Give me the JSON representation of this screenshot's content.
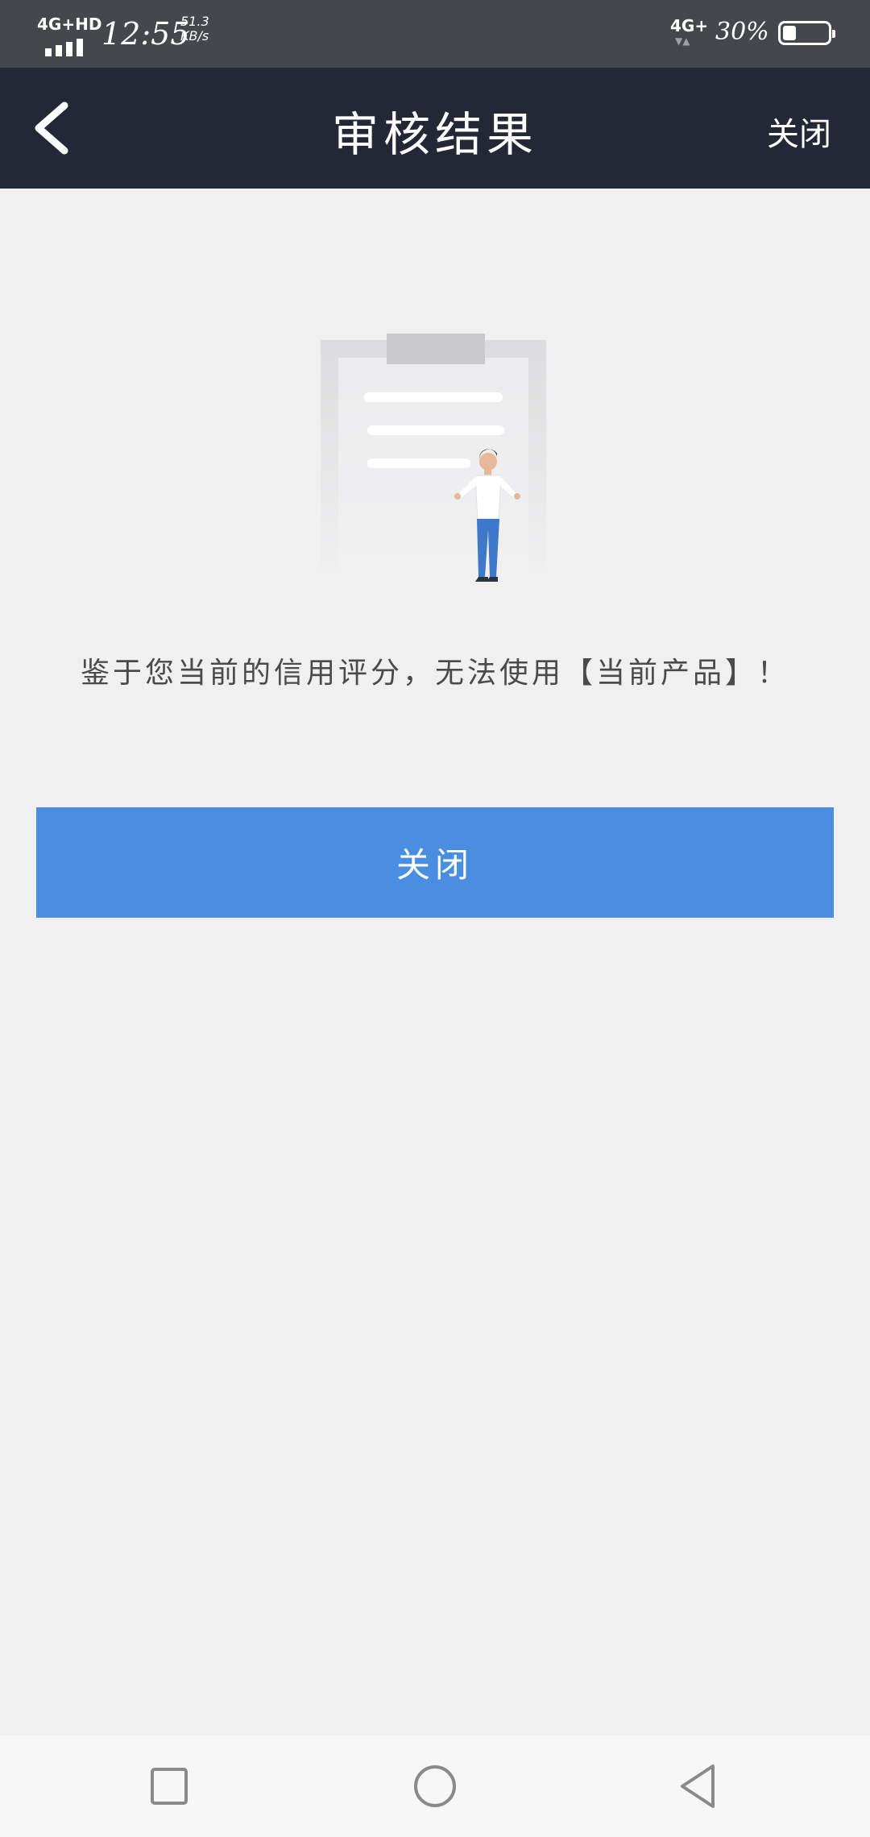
{
  "status_bar": {
    "network_left": "4G+HD",
    "time": "12:55",
    "speed": "51.3 KB/s",
    "network_right": "4G+",
    "battery_text": "30%",
    "battery_level": 0.3
  },
  "nav": {
    "title": "审核结果",
    "close_label": "关闭",
    "back_icon": "chevron-left-icon"
  },
  "main": {
    "illustration_icon": "clipboard-person-illustration",
    "message": "鉴于您当前的信用评分，无法使用【当前产品】！",
    "close_button_label": "关闭",
    "button_color": "#4a8ee2"
  },
  "system_nav": {
    "recent_icon": "square-icon",
    "home_icon": "circle-icon",
    "back_icon": "triangle-back-icon"
  }
}
